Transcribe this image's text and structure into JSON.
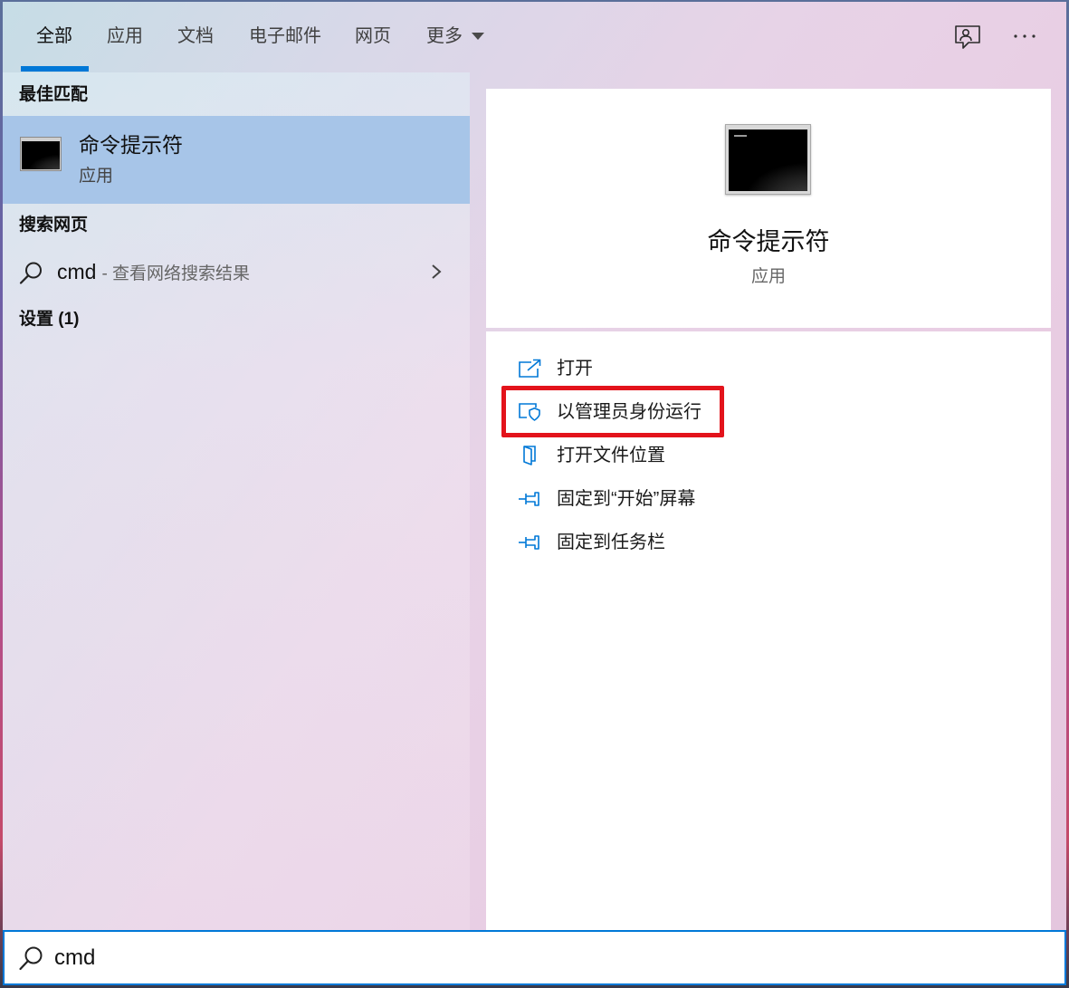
{
  "colors": {
    "accent": "#0078d7",
    "highlight_box": "#e3131b",
    "selected_row": "#a7c5e8"
  },
  "header": {
    "tabs": [
      {
        "label": "全部",
        "active": true
      },
      {
        "label": "应用",
        "active": false
      },
      {
        "label": "文档",
        "active": false
      },
      {
        "label": "电子邮件",
        "active": false
      },
      {
        "label": "网页",
        "active": false
      },
      {
        "label": "更多",
        "active": false
      }
    ],
    "more_dropdown_icon": "caret-down-icon",
    "feedback_icon": "feedback-icon",
    "options_icon": "ellipsis-icon"
  },
  "results": {
    "best_match_heading": "最佳匹配",
    "best_match": {
      "title": "命令提示符",
      "subtitle": "应用",
      "icon": "command-prompt-icon"
    },
    "web_heading": "搜索网页",
    "web_result": {
      "query": "cmd",
      "suffix": "- 查看网络搜索结果",
      "icon": "search-icon"
    },
    "settings_heading": "设置 (1)"
  },
  "preview": {
    "title": "命令提示符",
    "subtitle": "应用",
    "icon": "command-prompt-icon"
  },
  "actions": [
    {
      "label": "打开",
      "icon": "open-icon",
      "highlighted": false
    },
    {
      "label": "以管理员身份运行",
      "icon": "run-as-admin-shield-icon",
      "highlighted": true
    },
    {
      "label": "打开文件位置",
      "icon": "file-location-icon",
      "highlighted": false
    },
    {
      "label": "固定到“开始”屏幕",
      "icon": "pin-icon",
      "highlighted": false
    },
    {
      "label": "固定到任务栏",
      "icon": "pin-icon",
      "highlighted": false
    }
  ],
  "search": {
    "value": "cmd",
    "icon": "search-icon"
  }
}
